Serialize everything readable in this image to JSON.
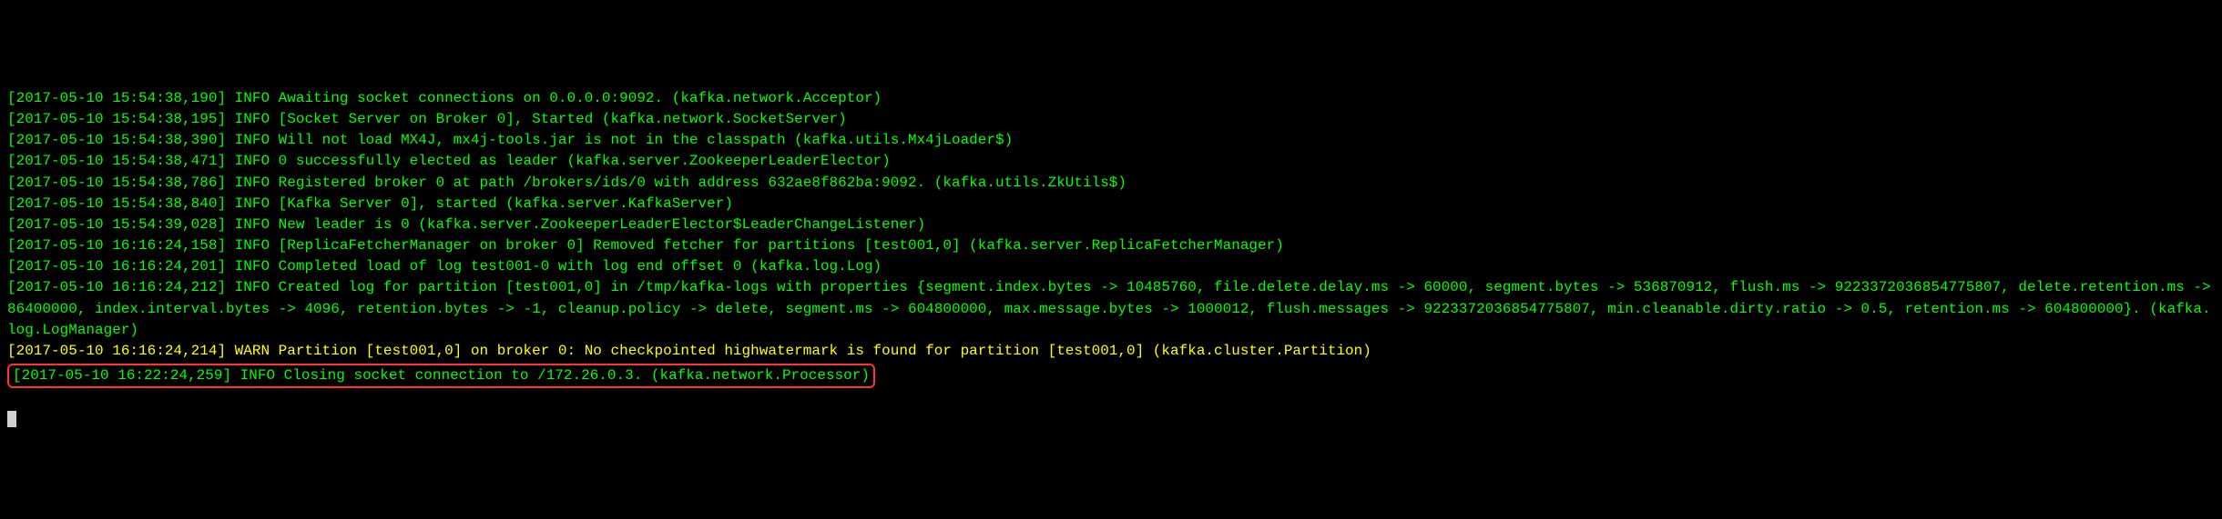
{
  "logs": [
    {
      "text": "[2017-05-10 15:54:38,190] INFO Awaiting socket connections on 0.0.0.0:9092. (kafka.network.Acceptor)",
      "level": "INFO"
    },
    {
      "text": "[2017-05-10 15:54:38,195] INFO [Socket Server on Broker 0], Started (kafka.network.SocketServer)",
      "level": "INFO"
    },
    {
      "text": "[2017-05-10 15:54:38,390] INFO Will not load MX4J, mx4j-tools.jar is not in the classpath (kafka.utils.Mx4jLoader$)",
      "level": "INFO"
    },
    {
      "text": "[2017-05-10 15:54:38,471] INFO 0 successfully elected as leader (kafka.server.ZookeeperLeaderElector)",
      "level": "INFO"
    },
    {
      "text": "[2017-05-10 15:54:38,786] INFO Registered broker 0 at path /brokers/ids/0 with address 632ae8f862ba:9092. (kafka.utils.ZkUtils$)",
      "level": "INFO"
    },
    {
      "text": "[2017-05-10 15:54:38,840] INFO [Kafka Server 0], started (kafka.server.KafkaServer)",
      "level": "INFO"
    },
    {
      "text": "[2017-05-10 15:54:39,028] INFO New leader is 0 (kafka.server.ZookeeperLeaderElector$LeaderChangeListener)",
      "level": "INFO"
    },
    {
      "text": "[2017-05-10 16:16:24,158] INFO [ReplicaFetcherManager on broker 0] Removed fetcher for partitions [test001,0] (kafka.server.ReplicaFetcherManager)",
      "level": "INFO"
    },
    {
      "text": "[2017-05-10 16:16:24,201] INFO Completed load of log test001-0 with log end offset 0 (kafka.log.Log)",
      "level": "INFO"
    },
    {
      "text": "[2017-05-10 16:16:24,212] INFO Created log for partition [test001,0] in /tmp/kafka-logs with properties {segment.index.bytes -> 10485760, file.delete.delay.ms -> 60000, segment.bytes -> 536870912, flush.ms -> 9223372036854775807, delete.retention.ms -> 86400000, index.interval.bytes -> 4096, retention.bytes -> -1, cleanup.policy -> delete, segment.ms -> 604800000, max.message.bytes -> 1000012, flush.messages -> 9223372036854775807, min.cleanable.dirty.ratio -> 0.5, retention.ms -> 604800000}. (kafka.log.LogManager)",
      "level": "INFO"
    },
    {
      "text": "[2017-05-10 16:16:24,214] WARN Partition [test001,0] on broker 0: No checkpointed highwatermark is found for partition [test001,0] (kafka.cluster.Partition)",
      "level": "WARN"
    },
    {
      "text": "[2017-05-10 16:22:24,259] INFO Closing socket connection to /172.26.0.3. (kafka.network.Processor)",
      "level": "INFO",
      "highlighted": true
    }
  ]
}
